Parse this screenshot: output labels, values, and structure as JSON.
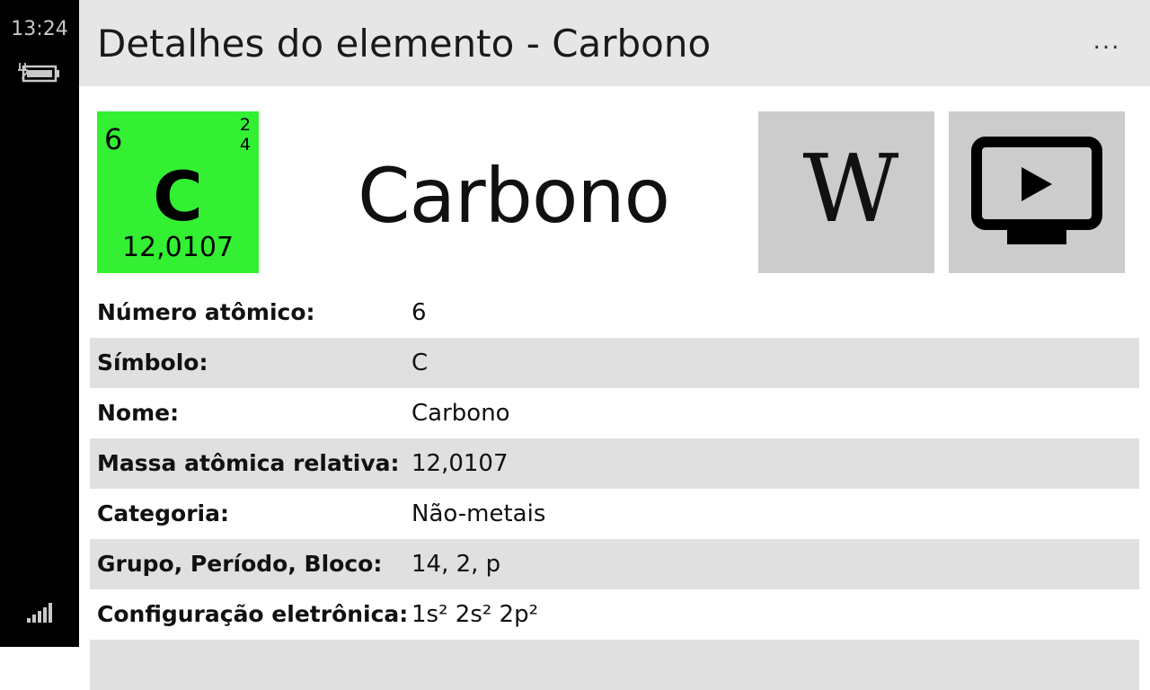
{
  "status": {
    "time": "13:24",
    "battery_icon": "battery-charging-icon",
    "signal_icon": "signal-strength-icon"
  },
  "header": {
    "title": "Detalhes do elemento - Carbono",
    "more_label": "..."
  },
  "tile": {
    "atomic_number": "6",
    "shell_1": "2",
    "shell_2": "4",
    "symbol": "C",
    "atomic_mass": "12,0107",
    "color": "#33f033"
  },
  "element_name": "Carbono",
  "actions": {
    "wiki_label": "W",
    "wiki_icon": "wikipedia-icon",
    "video_icon": "video-play-icon"
  },
  "properties": [
    {
      "label": "Número atômico:",
      "value": "6"
    },
    {
      "label": "Símbolo:",
      "value": "C"
    },
    {
      "label": "Nome:",
      "value": "Carbono"
    },
    {
      "label": "Massa atômica relativa:",
      "value": "12,0107"
    },
    {
      "label": "Categoria:",
      "value": "Não-metais"
    },
    {
      "label": "Grupo, Período, Bloco:",
      "value": "14, 2, p"
    },
    {
      "label": "Configuração eletrônica:",
      "value": "1s² 2s² 2p²"
    }
  ]
}
